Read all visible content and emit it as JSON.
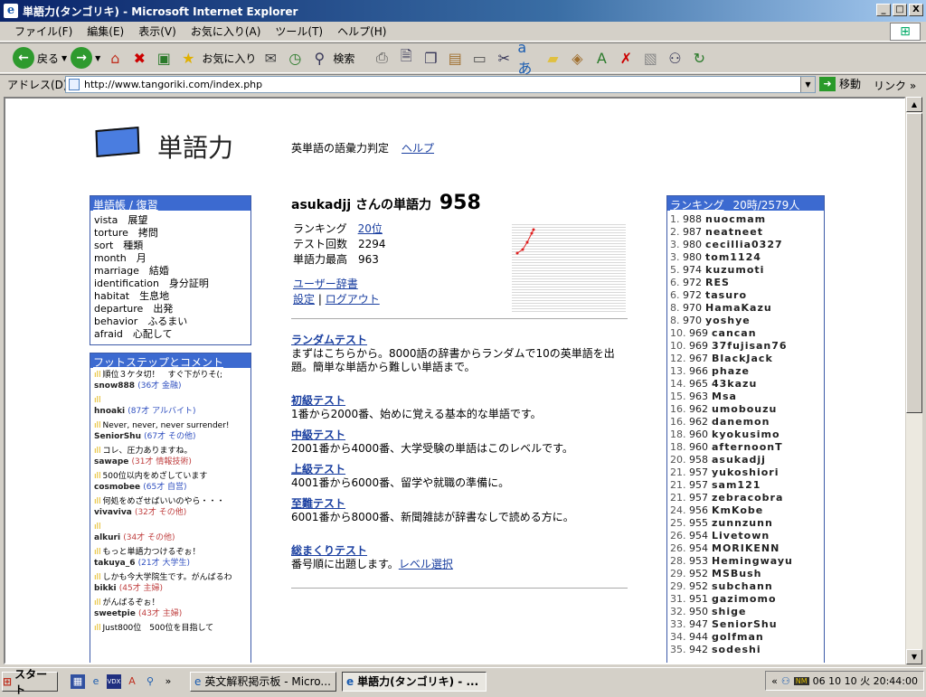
{
  "window": {
    "title": "単語力(タンゴリキ) - Microsoft Internet Explorer",
    "controls": [
      "_",
      "□",
      "X"
    ]
  },
  "menu": [
    "ファイル(F)",
    "編集(E)",
    "表示(V)",
    "お気に入り(A)",
    "ツール(T)",
    "ヘルプ(H)"
  ],
  "toolbar": {
    "back": "戻る",
    "search": "検索",
    "favorites": "お気に入り"
  },
  "address": {
    "label": "アドレス(D)",
    "url": "http://www.tangoriki.com/index.php",
    "go": "移動",
    "links": "リンク"
  },
  "site": {
    "name": "単語力",
    "tagline": "英単語の語彙力判定",
    "help": "ヘルプ"
  },
  "wordbook": {
    "header": "単語帳 / 復習",
    "rows": [
      "vista　展望",
      "torture　拷問",
      "sort　種類",
      "month　月",
      "marriage　結婚",
      "identification　身分証明",
      "habitat　生息地",
      "departure　出発",
      "behavior　ふるまい",
      "afraid　心配して"
    ]
  },
  "footsteps": {
    "header": "フットステップとコメント",
    "items": [
      {
        "comment": "順位３ケタ切！　すぐ下がりそ(;",
        "user": "snow888",
        "meta": "(36才 金融)",
        "metaColor": "blue"
      },
      {
        "comment": "",
        "user": "hnoaki",
        "meta": "(87才 アルバイト)",
        "metaColor": "blue"
      },
      {
        "comment": "Never, never, never surrender!",
        "user": "SeniorShu",
        "meta": "(67才 その他)",
        "metaColor": "blue"
      },
      {
        "comment": "コレ、圧力ありますね。",
        "user": "sawape",
        "meta": "(31才 情報技術)",
        "metaColor": "red"
      },
      {
        "comment": "500位以内をめざしています",
        "user": "cosmobee",
        "meta": "(65才 自営)",
        "metaColor": "blue"
      },
      {
        "comment": "何処をめざせばいいのやら・・・",
        "user": "vivaviva",
        "meta": "(32才 その他)",
        "metaColor": "red"
      },
      {
        "comment": "",
        "user": "alkuri",
        "meta": "(34才 その他)",
        "metaColor": "red"
      },
      {
        "comment": "もっと単語力つけるぞぉ！",
        "user": "takuya_6",
        "meta": "(21才 大学生)",
        "metaColor": "blue"
      },
      {
        "comment": "しかも今大学院生です。がんばるわ",
        "user": "bikki",
        "meta": "(45才 主婦)",
        "metaColor": "red"
      },
      {
        "comment": "がんばるぞぉ！",
        "user": "sweetpie",
        "meta": "(43才 主婦)",
        "metaColor": "red"
      },
      {
        "comment": "Just800位　500位を目指して",
        "user": "",
        "meta": "",
        "metaColor": "blue"
      }
    ]
  },
  "profile": {
    "user": "asukadjj",
    "title_suffix": "さんの単語力",
    "score": "958",
    "ranking_label": "ランキング",
    "ranking_value": "20位",
    "tests_label": "テスト回数",
    "tests_value": "2294",
    "best_label": "単語力最高",
    "best_value": "963",
    "user_dict": "ユーザー辞書",
    "settings": "設定",
    "separator": "|",
    "logout": "ログアウト"
  },
  "tests": [
    {
      "title": "ランダムテスト",
      "desc": "まずはこちらから。8000語の辞書からランダムで10の英単語を出題。簡単な単語から難しい単語まで。"
    },
    {
      "title": "初級テスト",
      "desc": "1番から2000番、始めに覚える基本的な単語です。"
    },
    {
      "title": "中級テスト",
      "desc": "2001番から4000番、大学受験の単語はこのレベルです。"
    },
    {
      "title": "上級テスト",
      "desc": "4001番から6000番、留学や就職の準備に。"
    },
    {
      "title": "至難テスト",
      "desc": "6001番から8000番、新聞雑誌が辞書なしで読める方に。"
    }
  ],
  "review": {
    "title": "総まくりテスト",
    "desc": "番号順に出題します。",
    "level": "レベル選択"
  },
  "ranking": {
    "header": "ランキング",
    "header_meta": "20時/2579人",
    "rows": [
      {
        "rank": "1.",
        "score": "988",
        "name": "nuocmam"
      },
      {
        "rank": "2.",
        "score": "987",
        "name": "neatneet"
      },
      {
        "rank": "3.",
        "score": "980",
        "name": "cecillia0327"
      },
      {
        "rank": "3.",
        "score": "980",
        "name": "tom1124"
      },
      {
        "rank": "5.",
        "score": "974",
        "name": "kuzumoti"
      },
      {
        "rank": "6.",
        "score": "972",
        "name": "RES"
      },
      {
        "rank": "6.",
        "score": "972",
        "name": "tasuro"
      },
      {
        "rank": "8.",
        "score": "970",
        "name": "HamaKazu"
      },
      {
        "rank": "8.",
        "score": "970",
        "name": "yoshye"
      },
      {
        "rank": "10.",
        "score": "969",
        "name": "cancan"
      },
      {
        "rank": "10.",
        "score": "969",
        "name": "37fujisan76"
      },
      {
        "rank": "12.",
        "score": "967",
        "name": "BlackJack"
      },
      {
        "rank": "13.",
        "score": "966",
        "name": "phaze"
      },
      {
        "rank": "14.",
        "score": "965",
        "name": "43kazu"
      },
      {
        "rank": "15.",
        "score": "963",
        "name": "Msa"
      },
      {
        "rank": "16.",
        "score": "962",
        "name": "umobouzu"
      },
      {
        "rank": "16.",
        "score": "962",
        "name": "danemon"
      },
      {
        "rank": "18.",
        "score": "960",
        "name": "kyokusimo"
      },
      {
        "rank": "18.",
        "score": "960",
        "name": "afternoonT"
      },
      {
        "rank": "20.",
        "score": "958",
        "name": "asukadjj"
      },
      {
        "rank": "21.",
        "score": "957",
        "name": "yukoshiori"
      },
      {
        "rank": "21.",
        "score": "957",
        "name": "sam121"
      },
      {
        "rank": "21.",
        "score": "957",
        "name": "zebracobra"
      },
      {
        "rank": "24.",
        "score": "956",
        "name": "KmKobe"
      },
      {
        "rank": "25.",
        "score": "955",
        "name": "zunnzunn"
      },
      {
        "rank": "26.",
        "score": "954",
        "name": "Livetown"
      },
      {
        "rank": "26.",
        "score": "954",
        "name": "MORIKENN"
      },
      {
        "rank": "28.",
        "score": "953",
        "name": "Hemingwayu"
      },
      {
        "rank": "29.",
        "score": "952",
        "name": "MSBush"
      },
      {
        "rank": "29.",
        "score": "952",
        "name": "subchann"
      },
      {
        "rank": "31.",
        "score": "951",
        "name": "gazimomo"
      },
      {
        "rank": "32.",
        "score": "950",
        "name": "shige"
      },
      {
        "rank": "33.",
        "score": "947",
        "name": "SeniorShu"
      },
      {
        "rank": "34.",
        "score": "944",
        "name": "golfman"
      },
      {
        "rank": "35.",
        "score": "942",
        "name": "sodeshi"
      }
    ]
  },
  "taskbar": {
    "start": "スタート",
    "tasks": [
      "英文解釈掲示板 - Micro...",
      "単語力(タンゴリキ) - ..."
    ],
    "clock": "06 10 10 火 20:44:00"
  },
  "colors": {
    "header_blue": "#3c6ad0",
    "link": "#1a3fa0",
    "graph_line": "#e02020"
  }
}
